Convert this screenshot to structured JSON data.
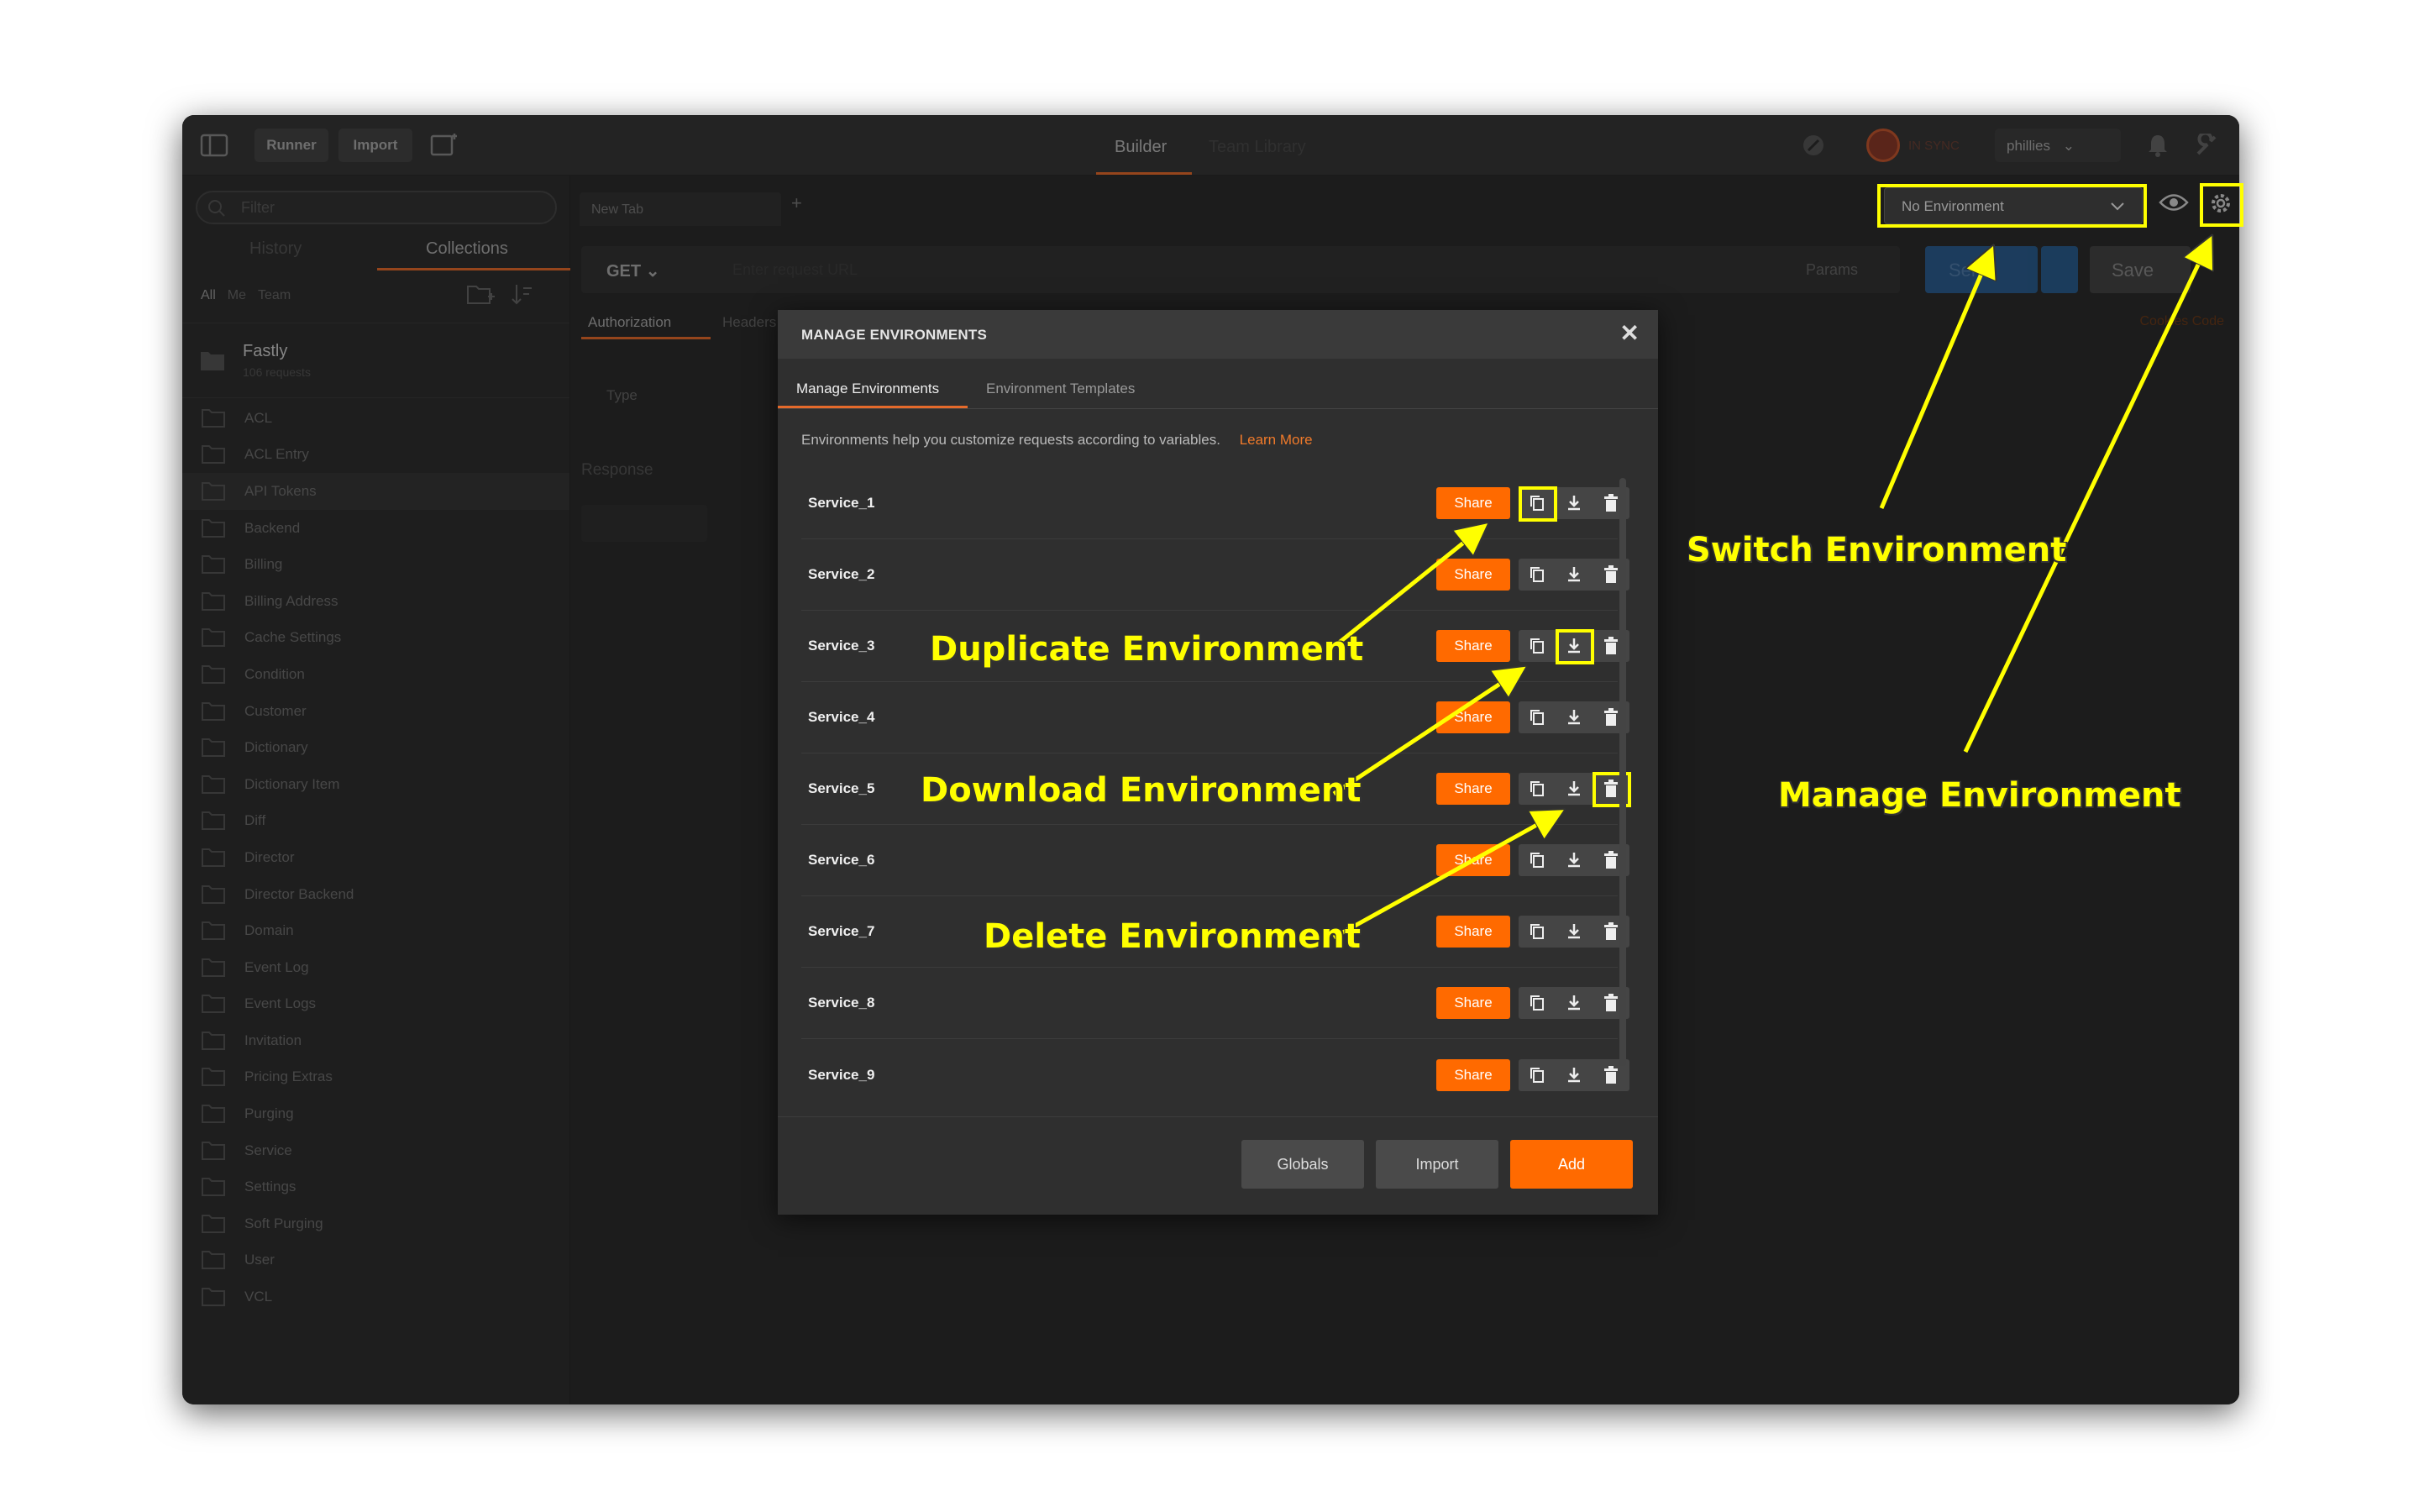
{
  "topbar": {
    "runner_label": "Runner",
    "import_label": "Import",
    "builder_tab": "Builder",
    "team_library_tab": "Team Library",
    "sync_status": "IN SYNC",
    "username": "phillies"
  },
  "sidebar": {
    "filter_placeholder": "Filter",
    "tab_history": "History",
    "tab_collections": "Collections",
    "sub_all": "All",
    "sub_me": "Me",
    "sub_team": "Team",
    "collection_name": "Fastly",
    "collection_sub": "106 requests",
    "folders": [
      "ACL",
      "ACL Entry",
      "API Tokens",
      "Backend",
      "Billing",
      "Billing Address",
      "Cache Settings",
      "Condition",
      "Customer",
      "Dictionary",
      "Dictionary Item",
      "Diff",
      "Director",
      "Director Backend",
      "Domain",
      "Event Log",
      "Event Logs",
      "Invitation",
      "Pricing Extras",
      "Purging",
      "Service",
      "Settings",
      "Soft Purging",
      "User",
      "VCL"
    ]
  },
  "main": {
    "new_tab_label": "New Tab",
    "method": "GET",
    "url_placeholder": "Enter request URL",
    "params_label": "Params",
    "send_label": "Send",
    "save_label": "Save",
    "auth_tab": "Authorization",
    "headers_tab": "Headers",
    "cookies_code": "Cookies  Code",
    "type_label": "Type",
    "response_label": "Response",
    "environment_select": "No Environment"
  },
  "modal": {
    "title": "MANAGE ENVIRONMENTS",
    "close": "✕",
    "tab_manage": "Manage Environments",
    "tab_templates": "Environment Templates",
    "description": "Environments help you customize requests according to variables.",
    "learn_more": "Learn More",
    "share_label": "Share",
    "environments": [
      "Service_1",
      "Service_2",
      "Service_3",
      "Service_4",
      "Service_5",
      "Service_6",
      "Service_7",
      "Service_8",
      "Service_9"
    ],
    "footer": {
      "globals_label": "Globals",
      "import_label": "Import",
      "add_label": "Add"
    }
  },
  "annotations": {
    "switch_environment": "Switch Environment",
    "manage_environment": "Manage Environment",
    "duplicate_environment": "Duplicate Environment",
    "download_environment": "Download Environment",
    "delete_environment": "Delete Environment",
    "color": "#ffff00"
  },
  "colors": {
    "accent": "#ff6a00",
    "tab_underline": "#e56a2b",
    "send_blue": "#2b6aa8"
  }
}
